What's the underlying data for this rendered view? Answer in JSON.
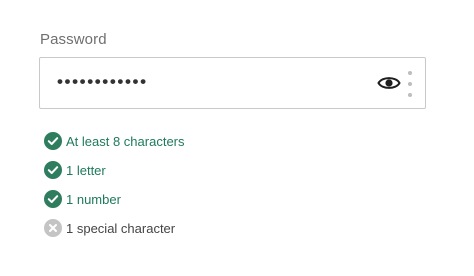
{
  "password": {
    "label": "Password",
    "value": "••••••••••••",
    "eye_icon": "eye-icon",
    "more_icon": "more-vertical-icon"
  },
  "requirements": {
    "items": [
      {
        "label": "At least 8 characters",
        "met": true
      },
      {
        "label": "1 letter",
        "met": true
      },
      {
        "label": "1 number",
        "met": true
      },
      {
        "label": "1 special character",
        "met": false
      }
    ]
  },
  "colors": {
    "success": "#2e7d5e",
    "success_text": "#1f7a5c",
    "unmet": "#c4c4c4",
    "border": "#c9c9c9",
    "label": "#6f6f6f"
  }
}
